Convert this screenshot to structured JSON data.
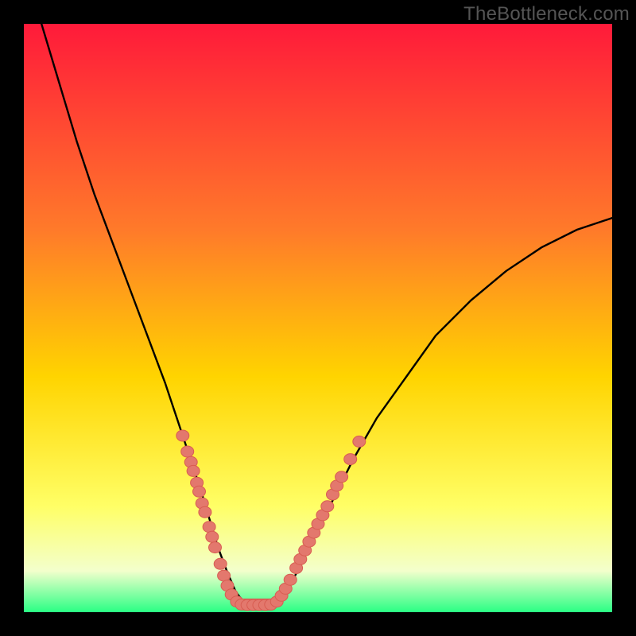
{
  "watermark": "TheBottleneck.com",
  "colors": {
    "grad_top": "#ff1a3a",
    "grad_mid1": "#ff7a2a",
    "grad_mid2": "#ffd400",
    "grad_low1": "#ffff66",
    "grad_low2": "#f3ffcc",
    "grad_bottom": "#2aff84",
    "curve": "#000000",
    "dot_fill": "#e3786d",
    "dot_stroke": "#d85d52"
  },
  "chart_data": {
    "type": "line",
    "title": "",
    "xlabel": "",
    "ylabel": "",
    "x_range": [
      0,
      100
    ],
    "y_range": [
      0,
      100
    ],
    "series": [
      {
        "name": "bottleneck-curve",
        "x": [
          3,
          6,
          9,
          12,
          15,
          18,
          21,
          24,
          26,
          28,
          30,
          31.5,
          33,
          34.5,
          36,
          37.5,
          39,
          42,
          45,
          48,
          52,
          56,
          60,
          65,
          70,
          76,
          82,
          88,
          94,
          100
        ],
        "y": [
          100,
          90,
          80,
          71,
          63,
          55,
          47,
          39,
          33,
          27,
          21,
          16,
          11,
          7,
          3.5,
          1.5,
          1.3,
          1.3,
          4,
          10,
          18,
          26,
          33,
          40,
          47,
          53,
          58,
          62,
          65,
          67
        ]
      }
    ],
    "flat_bottom": {
      "x_start": 36.5,
      "x_end": 43,
      "y": 1.3
    },
    "dots": [
      {
        "x": 27.0,
        "y": 30.0
      },
      {
        "x": 27.8,
        "y": 27.3
      },
      {
        "x": 28.4,
        "y": 25.5
      },
      {
        "x": 28.8,
        "y": 24.0
      },
      {
        "x": 29.4,
        "y": 22.0
      },
      {
        "x": 29.8,
        "y": 20.5
      },
      {
        "x": 30.3,
        "y": 18.5
      },
      {
        "x": 30.8,
        "y": 17.0
      },
      {
        "x": 31.5,
        "y": 14.5
      },
      {
        "x": 32.0,
        "y": 12.8
      },
      {
        "x": 32.5,
        "y": 11.0
      },
      {
        "x": 33.4,
        "y": 8.2
      },
      {
        "x": 34.0,
        "y": 6.2
      },
      {
        "x": 34.6,
        "y": 4.5
      },
      {
        "x": 35.3,
        "y": 3.0
      },
      {
        "x": 36.2,
        "y": 1.8
      },
      {
        "x": 37.0,
        "y": 1.3
      },
      {
        "x": 38.0,
        "y": 1.2
      },
      {
        "x": 39.0,
        "y": 1.2
      },
      {
        "x": 40.0,
        "y": 1.2
      },
      {
        "x": 41.0,
        "y": 1.2
      },
      {
        "x": 42.0,
        "y": 1.3
      },
      {
        "x": 43.0,
        "y": 1.8
      },
      {
        "x": 43.8,
        "y": 2.8
      },
      {
        "x": 44.5,
        "y": 4.0
      },
      {
        "x": 45.3,
        "y": 5.5
      },
      {
        "x": 46.3,
        "y": 7.5
      },
      {
        "x": 47.0,
        "y": 9.0
      },
      {
        "x": 47.8,
        "y": 10.5
      },
      {
        "x": 48.5,
        "y": 12.0
      },
      {
        "x": 49.3,
        "y": 13.5
      },
      {
        "x": 50.0,
        "y": 15.0
      },
      {
        "x": 50.8,
        "y": 16.5
      },
      {
        "x": 51.6,
        "y": 18.0
      },
      {
        "x": 52.5,
        "y": 20.0
      },
      {
        "x": 53.2,
        "y": 21.5
      },
      {
        "x": 54.0,
        "y": 23.0
      },
      {
        "x": 55.5,
        "y": 26.0
      },
      {
        "x": 57.0,
        "y": 29.0
      }
    ]
  }
}
